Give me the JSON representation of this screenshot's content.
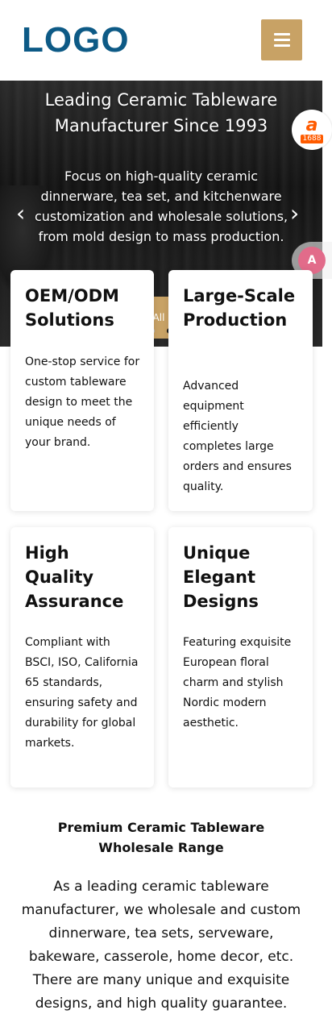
{
  "header": {
    "logo_text": "LOGO",
    "menu_icon": "hamburger-menu-icon"
  },
  "hero": {
    "title": "Leading Ceramic Tableware Manufacturer Since 1993",
    "subtitle": "Focus on high-quality ceramic dinnerware, tea set, and kitchenware customization and wholesale solutions, from mold design to mass production.",
    "button_label": "All",
    "prev_icon": "chevron-left-icon",
    "next_icon": "chevron-right-icon"
  },
  "side_badges": {
    "alibaba_label": "1688",
    "alibaba_mark": "a",
    "translate_label": "A"
  },
  "features": [
    {
      "title": "OEM/ODM Solutions",
      "text": "One-stop service for custom tableware design to meet the unique needs of your brand."
    },
    {
      "title": "Large-Scale Production",
      "text": "Advanced equipment efficiently completes large orders and ensures quality."
    },
    {
      "title": "High Quality Assurance",
      "text": "Compliant with BSCI, ISO, California 65 standards, ensuring safety and durability for global markets."
    },
    {
      "title": "Unique Elegant Designs",
      "text": "Featuring exquisite European floral charm and stylish Nordic modern aesthetic."
    }
  ],
  "range": {
    "title": "Premium Ceramic Tableware Wholesale Range",
    "text": "As a leading ceramic tableware manufacturer, we wholesale and custom dinnerware, tea sets, serveware, bakeware, casserole, home decor, etc. There are many unique and exquisite designs, and high quality guarantee."
  },
  "colors": {
    "brand_blue": "#0d5a86",
    "accent_gold": "#c8a265",
    "alibaba_orange": "#ff5b00"
  }
}
